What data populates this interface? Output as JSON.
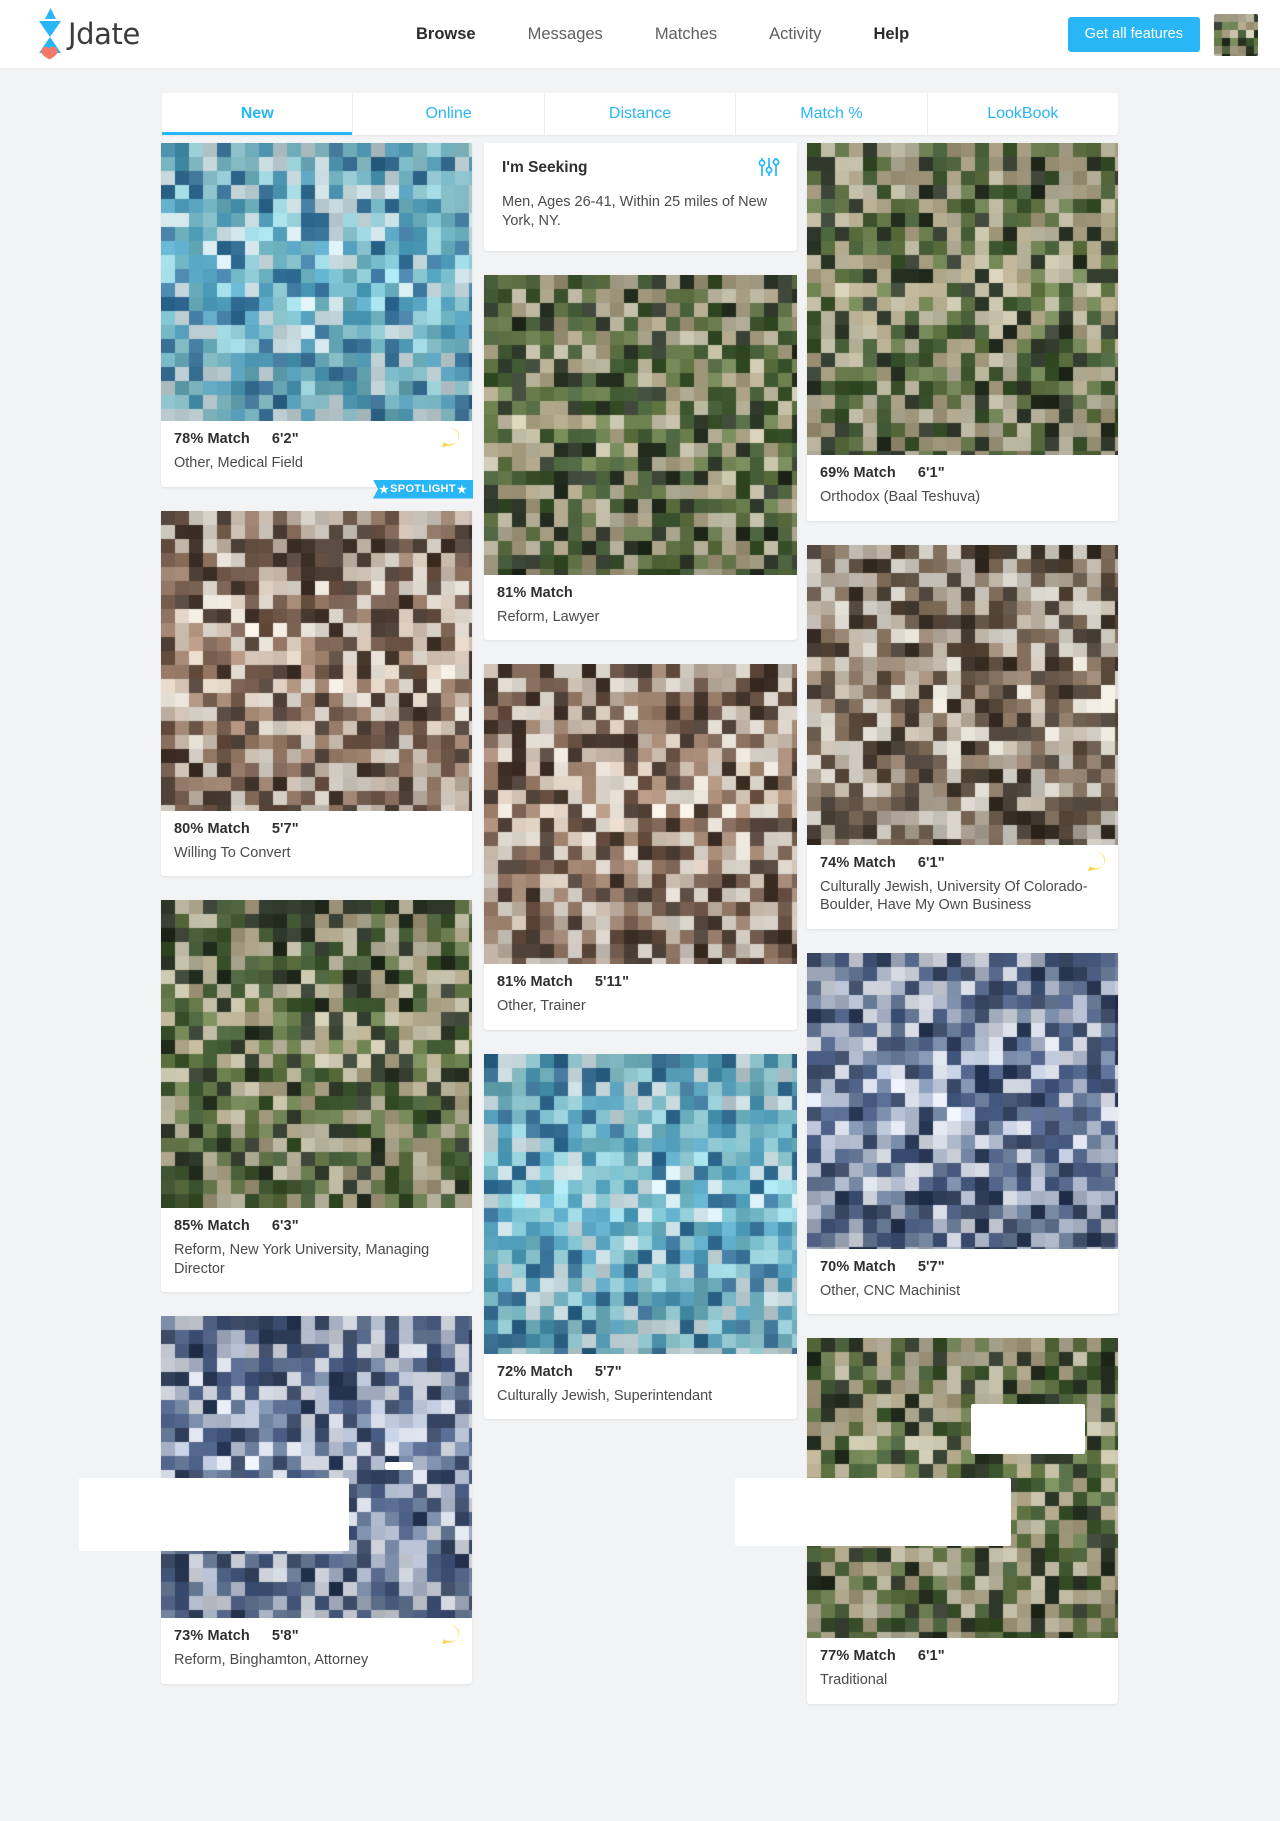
{
  "brand": {
    "name": "Jdate",
    "accent": "#29b6f6",
    "heart_color": "#f4796b"
  },
  "header": {
    "nav": [
      {
        "label": "Browse",
        "active": true
      },
      {
        "label": "Messages",
        "active": false
      },
      {
        "label": "Matches",
        "active": false
      },
      {
        "label": "Activity",
        "active": false
      },
      {
        "label": "Help",
        "active": true
      }
    ],
    "cta_label": "Get all features",
    "avatar_name": "user-avatar"
  },
  "tabs": [
    {
      "label": "New",
      "active": true
    },
    {
      "label": "Online",
      "active": false
    },
    {
      "label": "Distance",
      "active": false
    },
    {
      "label": "Match %",
      "active": false
    },
    {
      "label": "LookBook",
      "active": false
    }
  ],
  "seeking": {
    "title": "I'm Seeking",
    "criteria": "Men, Ages 26-41, Within 25 miles of New York, NY.",
    "filter_icon": "sliders-icon"
  },
  "columns": [
    {
      "name": "column-left",
      "cards": [
        {
          "match": "78% Match",
          "height": "6'2\"",
          "desc": "Other, Medical Field",
          "photo_h": 278,
          "seed": 11,
          "badge": true,
          "spotlight": "SPOTLIGHT"
        },
        {
          "match": "80% Match",
          "height": "5'7\"",
          "desc": "Willing To Convert",
          "photo_h": 300,
          "seed": 23,
          "badge": false,
          "spotlight": null
        },
        {
          "match": "85% Match",
          "height": "6'3\"",
          "desc": "Reform, New York University, Managing Director",
          "photo_h": 308,
          "seed": 37,
          "badge": false,
          "spotlight": null
        },
        {
          "match": "73% Match",
          "height": "5'8\"",
          "desc": "Reform, Binghamton, Attorney",
          "photo_h": 302,
          "seed": 44,
          "badge": true,
          "spotlight": null
        }
      ]
    },
    {
      "name": "column-middle",
      "cards": [
        {
          "match": "81% Match",
          "height": "",
          "desc": "Reform, Lawyer",
          "photo_h": 300,
          "seed": 52,
          "badge": false,
          "spotlight": null
        },
        {
          "match": "81% Match",
          "height": "5'11\"",
          "desc": "Other, Trainer",
          "photo_h": 300,
          "seed": 63,
          "badge": false,
          "spotlight": null
        },
        {
          "match": "72% Match",
          "height": "5'7\"",
          "desc": "Culturally Jewish, Superintendant",
          "photo_h": 300,
          "seed": 71,
          "badge": false,
          "spotlight": null
        }
      ]
    },
    {
      "name": "column-right",
      "cards": [
        {
          "match": "69% Match",
          "height": "6'1\"",
          "desc": "Orthodox (Baal Teshuva)",
          "photo_h": 312,
          "seed": 82,
          "badge": false,
          "spotlight": null
        },
        {
          "match": "74% Match",
          "height": "6'1\"",
          "desc": "Culturally Jewish, University Of Colorado-Boulder, Have My Own Business",
          "photo_h": 300,
          "seed": 95,
          "badge": true,
          "spotlight": null
        },
        {
          "match": "70% Match",
          "height": "5'7\"",
          "desc": "Other, CNC Machinist",
          "photo_h": 296,
          "seed": 104,
          "badge": false,
          "spotlight": null
        },
        {
          "match": "77% Match",
          "height": "6'1\"",
          "desc": "Traditional",
          "photo_h": 300,
          "seed": 117,
          "badge": false,
          "spotlight": null
        }
      ]
    }
  ]
}
